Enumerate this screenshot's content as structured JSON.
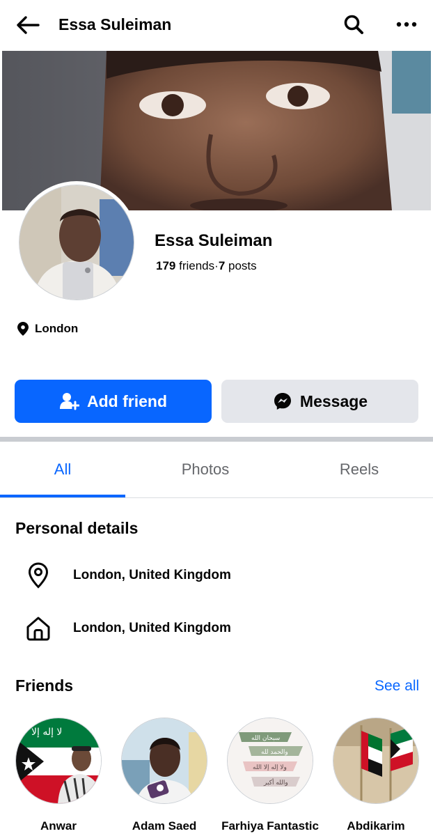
{
  "topbar": {
    "title": "Essa Suleiman"
  },
  "profile": {
    "name": "Essa Suleiman",
    "friends_count": "179",
    "friends_label": "friends",
    "separator": "·",
    "posts_count": "7",
    "posts_label": "posts",
    "location": "London"
  },
  "actions": {
    "add_friend": "Add friend",
    "message": "Message"
  },
  "tabs": [
    {
      "label": "All",
      "active": true
    },
    {
      "label": "Photos",
      "active": false
    },
    {
      "label": "Reels",
      "active": false
    }
  ],
  "personal_details": {
    "title": "Personal details",
    "items": [
      {
        "icon": "location-pin-icon",
        "text": "London, United Kingdom"
      },
      {
        "icon": "home-icon",
        "text": "London, United Kingdom"
      }
    ]
  },
  "friends": {
    "title": "Friends",
    "see_all": "See all",
    "items": [
      {
        "name": "Anwar"
      },
      {
        "name": "Adam Saed"
      },
      {
        "name": "Farhiya Fantastic"
      },
      {
        "name": "Abdikarim"
      }
    ]
  },
  "colors": {
    "accent": "#0866ff",
    "secondary_button": "#e4e6eb",
    "muted_text": "#65676b"
  }
}
